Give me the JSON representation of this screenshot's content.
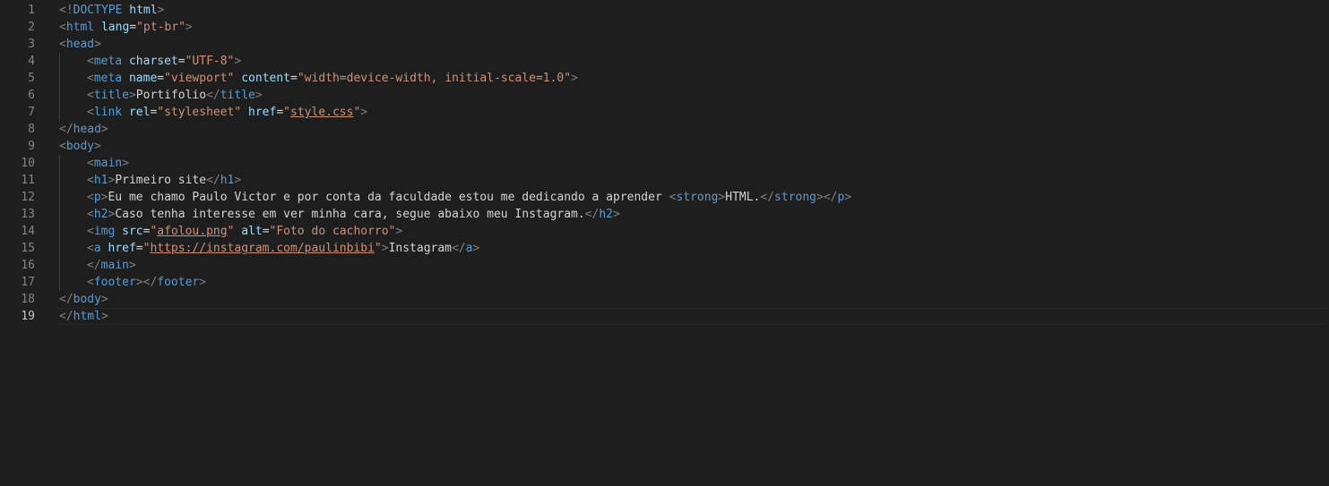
{
  "editor": {
    "language": "html",
    "current_line": 19,
    "lines": [
      {
        "n": "1",
        "indent": 0,
        "tokens": [
          [
            "br",
            "<!"
          ],
          [
            "tag",
            "DOCTYPE"
          ],
          [
            "txt",
            " "
          ],
          [
            "attr",
            "html"
          ],
          [
            "br",
            ">"
          ]
        ]
      },
      {
        "n": "2",
        "indent": 0,
        "tokens": [
          [
            "br",
            "<"
          ],
          [
            "tag",
            "html"
          ],
          [
            "txt",
            " "
          ],
          [
            "attr",
            "lang"
          ],
          [
            "txt",
            "="
          ],
          [
            "str",
            "\"pt-br\""
          ],
          [
            "br",
            ">"
          ]
        ]
      },
      {
        "n": "3",
        "indent": 0,
        "tokens": [
          [
            "br",
            "<"
          ],
          [
            "tag",
            "head"
          ],
          [
            "br",
            ">"
          ]
        ]
      },
      {
        "n": "4",
        "indent": 1,
        "tokens": [
          [
            "br",
            "<"
          ],
          [
            "tag",
            "meta"
          ],
          [
            "txt",
            " "
          ],
          [
            "attr",
            "charset"
          ],
          [
            "txt",
            "="
          ],
          [
            "str",
            "\"UTF-8\""
          ],
          [
            "br",
            ">"
          ]
        ]
      },
      {
        "n": "5",
        "indent": 1,
        "tokens": [
          [
            "br",
            "<"
          ],
          [
            "tag",
            "meta"
          ],
          [
            "txt",
            " "
          ],
          [
            "attr",
            "name"
          ],
          [
            "txt",
            "="
          ],
          [
            "str",
            "\"viewport\""
          ],
          [
            "txt",
            " "
          ],
          [
            "attr",
            "content"
          ],
          [
            "txt",
            "="
          ],
          [
            "str",
            "\"width=device-width, initial-scale=1.0\""
          ],
          [
            "br",
            ">"
          ]
        ]
      },
      {
        "n": "6",
        "indent": 1,
        "tokens": [
          [
            "br",
            "<"
          ],
          [
            "tag",
            "title"
          ],
          [
            "br",
            ">"
          ],
          [
            "txt",
            "Portifolio"
          ],
          [
            "br",
            "</"
          ],
          [
            "tag",
            "title"
          ],
          [
            "br",
            ">"
          ]
        ]
      },
      {
        "n": "7",
        "indent": 1,
        "tokens": [
          [
            "br",
            "<"
          ],
          [
            "tag",
            "link"
          ],
          [
            "txt",
            " "
          ],
          [
            "attr",
            "rel"
          ],
          [
            "txt",
            "="
          ],
          [
            "str",
            "\"stylesheet\""
          ],
          [
            "txt",
            " "
          ],
          [
            "attr",
            "href"
          ],
          [
            "txt",
            "="
          ],
          [
            "str",
            "\""
          ],
          [
            "link",
            "style.css"
          ],
          [
            "str",
            "\""
          ],
          [
            "br",
            ">"
          ]
        ]
      },
      {
        "n": "8",
        "indent": 0,
        "tokens": [
          [
            "br",
            "</"
          ],
          [
            "tag",
            "head"
          ],
          [
            "br",
            ">"
          ]
        ]
      },
      {
        "n": "9",
        "indent": 0,
        "tokens": [
          [
            "br",
            "<"
          ],
          [
            "tag",
            "body"
          ],
          [
            "br",
            ">"
          ]
        ]
      },
      {
        "n": "10",
        "indent": 1,
        "tokens": [
          [
            "br",
            "<"
          ],
          [
            "tag",
            "main"
          ],
          [
            "br",
            ">"
          ]
        ]
      },
      {
        "n": "11",
        "indent": 1,
        "tokens": [
          [
            "br",
            "<"
          ],
          [
            "tag",
            "h1"
          ],
          [
            "br",
            ">"
          ],
          [
            "txt",
            "Primeiro site"
          ],
          [
            "br",
            "</"
          ],
          [
            "tag",
            "h1"
          ],
          [
            "br",
            ">"
          ]
        ]
      },
      {
        "n": "12",
        "indent": 1,
        "tokens": [
          [
            "br",
            "<"
          ],
          [
            "tag",
            "p"
          ],
          [
            "br",
            ">"
          ],
          [
            "txt",
            "Eu me chamo Paulo Victor e por conta da faculdade estou me dedicando a aprender "
          ],
          [
            "br",
            "<"
          ],
          [
            "tag",
            "strong"
          ],
          [
            "br",
            ">"
          ],
          [
            "txt",
            "HTML."
          ],
          [
            "br",
            "</"
          ],
          [
            "tag",
            "strong"
          ],
          [
            "br",
            "></"
          ],
          [
            "tag",
            "p"
          ],
          [
            "br",
            ">"
          ]
        ]
      },
      {
        "n": "13",
        "indent": 1,
        "tokens": [
          [
            "br",
            "<"
          ],
          [
            "tag",
            "h2"
          ],
          [
            "br",
            ">"
          ],
          [
            "txt",
            "Caso tenha interesse em ver minha cara, segue abaixo meu Instagram."
          ],
          [
            "br",
            "</"
          ],
          [
            "tag",
            "h2"
          ],
          [
            "br",
            ">"
          ]
        ]
      },
      {
        "n": "14",
        "indent": 1,
        "tokens": [
          [
            "br",
            "<"
          ],
          [
            "tag",
            "img"
          ],
          [
            "txt",
            " "
          ],
          [
            "attr",
            "src"
          ],
          [
            "txt",
            "="
          ],
          [
            "str",
            "\""
          ],
          [
            "link",
            "afolou.png"
          ],
          [
            "str",
            "\""
          ],
          [
            "txt",
            " "
          ],
          [
            "attr",
            "alt"
          ],
          [
            "txt",
            "="
          ],
          [
            "str",
            "\"Foto do cachorro\""
          ],
          [
            "br",
            ">"
          ]
        ]
      },
      {
        "n": "15",
        "indent": 1,
        "tokens": [
          [
            "br",
            "<"
          ],
          [
            "tag",
            "a"
          ],
          [
            "txt",
            " "
          ],
          [
            "attr",
            "href"
          ],
          [
            "txt",
            "="
          ],
          [
            "str",
            "\""
          ],
          [
            "link",
            "https://instagram.com/paulinbibi"
          ],
          [
            "str",
            "\""
          ],
          [
            "br",
            ">"
          ],
          [
            "txt",
            "Instagram"
          ],
          [
            "br",
            "</"
          ],
          [
            "tag",
            "a"
          ],
          [
            "br",
            ">"
          ]
        ]
      },
      {
        "n": "16",
        "indent": 1,
        "tokens": [
          [
            "br",
            "</"
          ],
          [
            "tag",
            "main"
          ],
          [
            "br",
            ">"
          ]
        ]
      },
      {
        "n": "17",
        "indent": 1,
        "tokens": [
          [
            "br",
            "<"
          ],
          [
            "tag",
            "footer"
          ],
          [
            "br",
            "></"
          ],
          [
            "tag",
            "footer"
          ],
          [
            "br",
            ">"
          ]
        ]
      },
      {
        "n": "18",
        "indent": 0,
        "tokens": [
          [
            "br",
            "</"
          ],
          [
            "tag",
            "body"
          ],
          [
            "br",
            ">"
          ]
        ]
      },
      {
        "n": "19",
        "indent": 0,
        "tokens": [
          [
            "br",
            "</"
          ],
          [
            "tag",
            "html"
          ],
          [
            "br",
            ">"
          ]
        ]
      }
    ]
  }
}
